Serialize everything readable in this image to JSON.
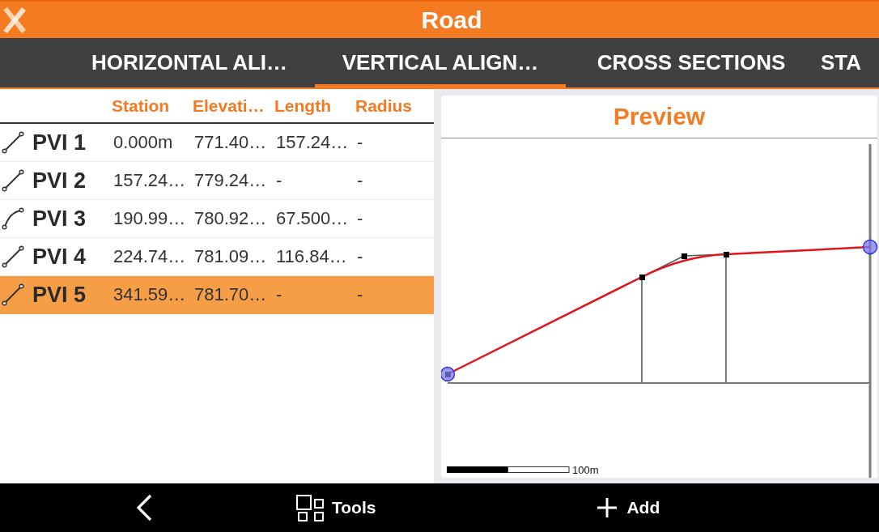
{
  "app_bar": {
    "title": "Road"
  },
  "tabs": [
    {
      "label": "HORIZONTAL ALI…",
      "selected": false
    },
    {
      "label": "VERTICAL ALIGN…",
      "selected": true
    },
    {
      "label": "CROSS SECTIONS",
      "selected": false
    },
    {
      "label": "STA",
      "selected": false
    }
  ],
  "table": {
    "columns": [
      "Station",
      "Elevati…",
      "Length",
      "Radius"
    ],
    "rows": [
      {
        "name": "PVI 1",
        "kind": "straight",
        "selected": false,
        "cells": [
          "0.000m",
          "771.40…",
          "157.24…",
          "-"
        ]
      },
      {
        "name": "PVI 2",
        "kind": "straight",
        "selected": false,
        "cells": [
          "157.24…",
          "779.24…",
          "-",
          "-"
        ]
      },
      {
        "name": "PVI 3",
        "kind": "curved",
        "selected": false,
        "cells": [
          "190.99…",
          "780.92…",
          "67.500…",
          "-"
        ]
      },
      {
        "name": "PVI 4",
        "kind": "straight",
        "selected": false,
        "cells": [
          "224.74…",
          "781.09…",
          "116.84…",
          "-"
        ]
      },
      {
        "name": "PVI 5",
        "kind": "straight",
        "selected": true,
        "cells": [
          "341.59…",
          "781.70…",
          "-",
          "-"
        ]
      }
    ]
  },
  "preview": {
    "title": "Preview",
    "scale_label": "100m"
  },
  "bottom_bar": {
    "buttons": [
      {
        "kind": "back"
      },
      {
        "kind": "tools",
        "label": "Tools"
      },
      {
        "kind": "add",
        "label": "Add"
      }
    ]
  }
}
